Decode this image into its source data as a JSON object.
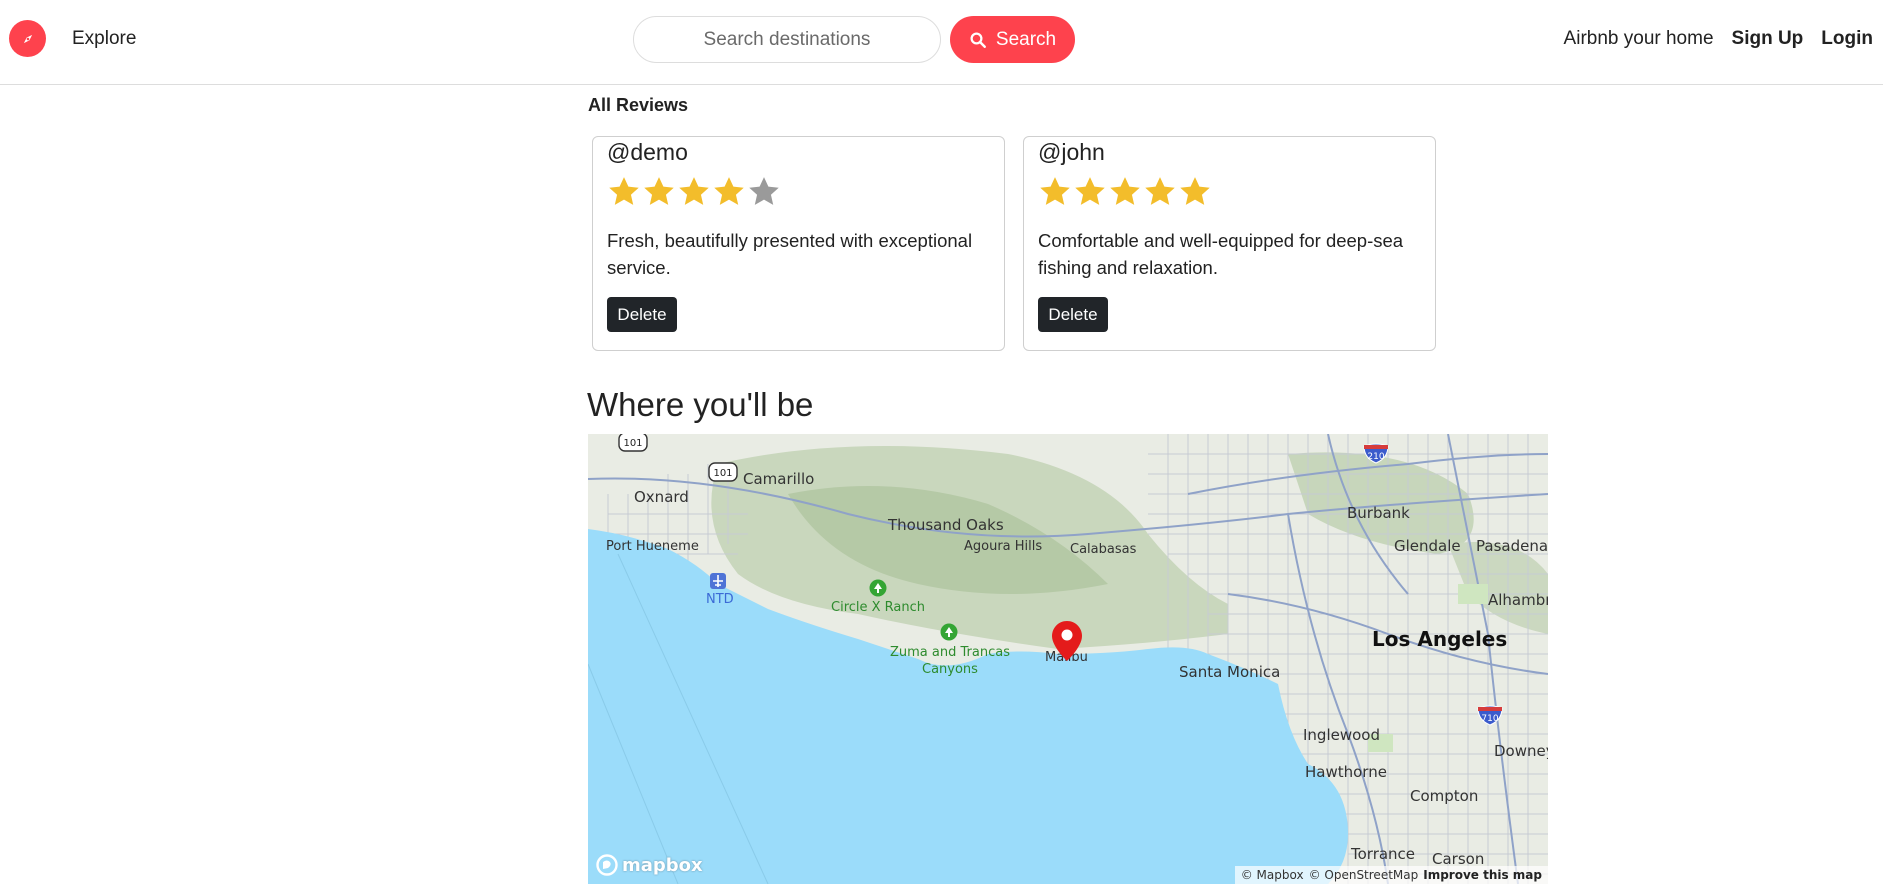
{
  "navbar": {
    "explore_label": "Explore",
    "search_placeholder": "Search destinations",
    "search_button_label": "Search",
    "host_link": "Airbnb your home",
    "signup_link": "Sign Up",
    "login_link": "Login"
  },
  "reviews": {
    "title": "All Reviews",
    "items": [
      {
        "author": "@demo",
        "rating": 4,
        "max_rating": 5,
        "comment": "Fresh, beautifully presented with exceptional service.",
        "delete_label": "Delete"
      },
      {
        "author": "@john",
        "rating": 5,
        "max_rating": 5,
        "comment": "Comfortable and well-equipped for deep-sea fishing and relaxation.",
        "delete_label": "Delete"
      }
    ]
  },
  "map_section": {
    "title": "Where you'll be",
    "labels": {
      "oxnard": "Oxnard",
      "camarillo": "Camarillo",
      "port_hueneme": "Port Hueneme",
      "thousand_oaks": "Thousand Oaks",
      "agoura_hills": "Agoura Hills",
      "calabasas": "Calabasas",
      "burbank": "Burbank",
      "glendale": "Glendale",
      "pasadena": "Pasadena",
      "alhambra": "Alhambr",
      "los_angeles": "Los Angeles",
      "santa_monica": "Santa Monica",
      "inglewood": "Inglewood",
      "hawthorne": "Hawthorne",
      "compton": "Compton",
      "downey": "Downey",
      "torrance": "Torrance",
      "carson": "Carson",
      "malibu": "Malibu",
      "circle_x_ranch": "Circle X Ranch",
      "zuma_and_trancas": "Zuma and Trancas",
      "canyons": "Canyons",
      "ntd": "NTD",
      "hwy_101_a": "101",
      "hwy_101_b": "101",
      "i_210": "210",
      "i_710": "710"
    },
    "mapbox_logo": "mapbox",
    "attribution_mapbox": "© Mapbox",
    "attribution_osm": "© OpenStreetMap",
    "improve_link": "Improve this map"
  },
  "colors": {
    "brand": "#fe424d",
    "star_filled": "#f3bd2b",
    "star_empty": "#9a9a9a",
    "delete_button": "#212529",
    "water": "#9bdcfa"
  }
}
